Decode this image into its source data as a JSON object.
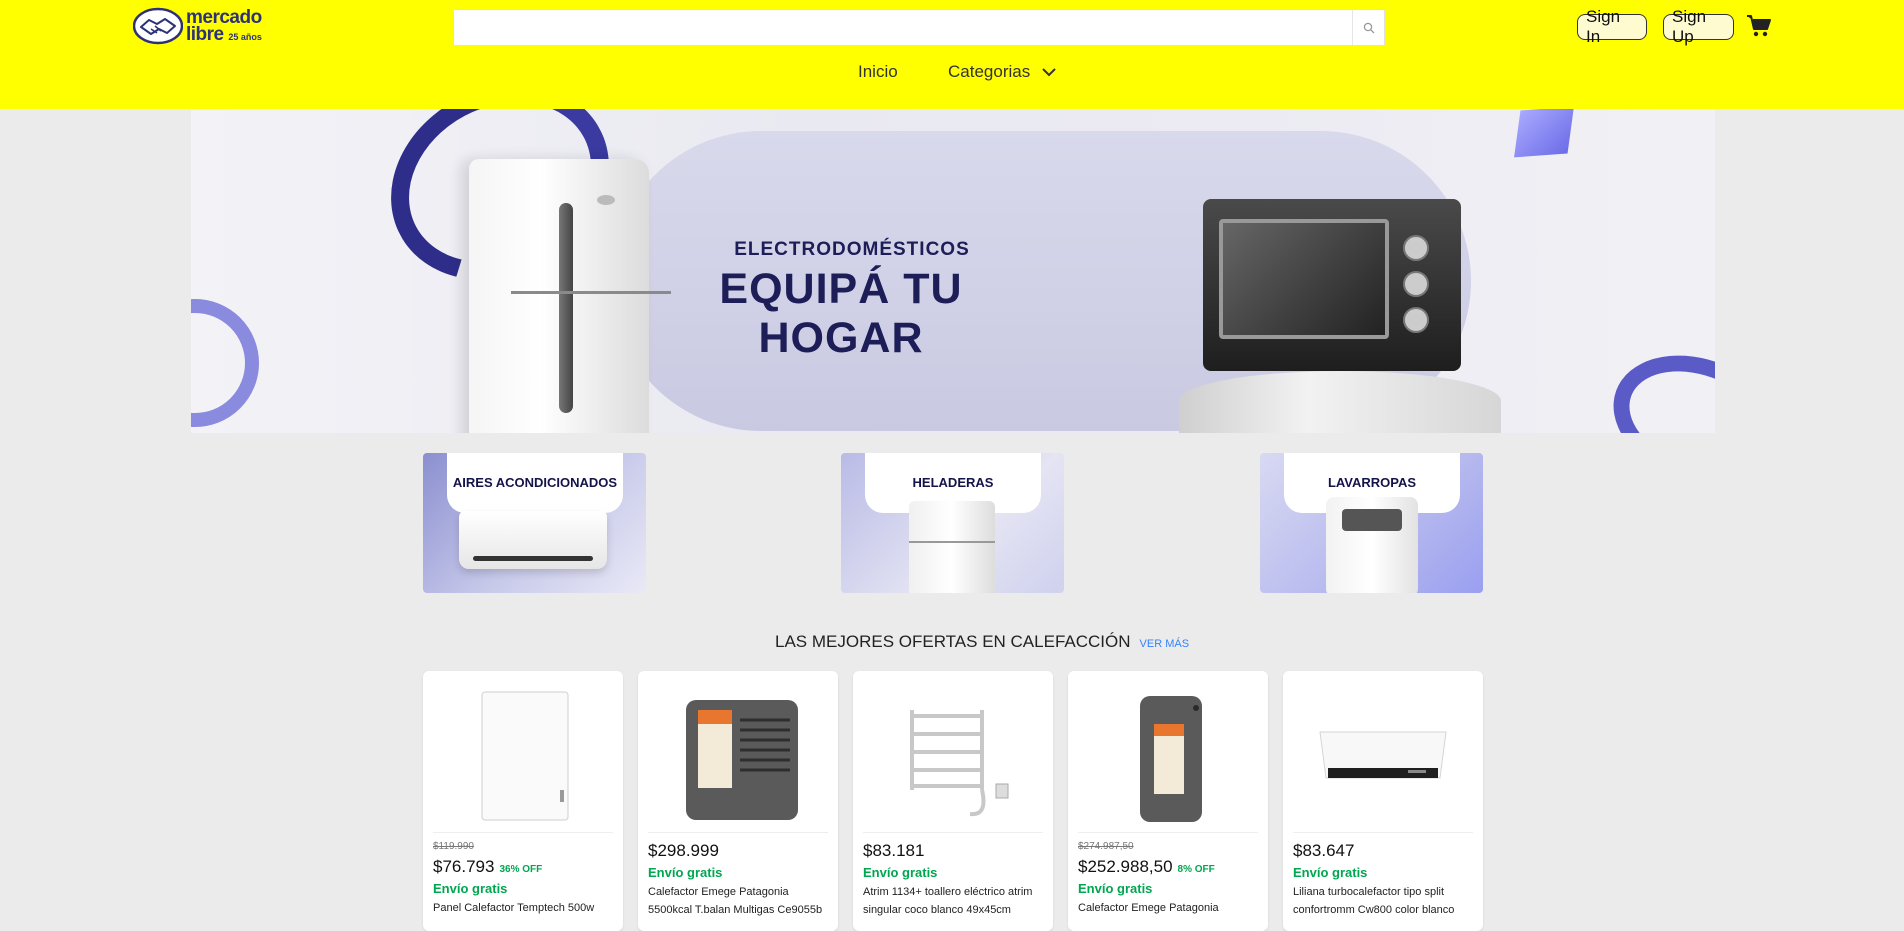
{
  "header": {
    "logo": {
      "brand_line1": "mercado",
      "brand_line2": "libre",
      "badge": "25 años"
    },
    "search": {
      "value": "",
      "placeholder": ""
    },
    "buttons": {
      "sign_in": "Sign In",
      "sign_up": "Sign Up"
    },
    "nav": {
      "home": "Inicio",
      "categories": "Categorias"
    },
    "icons": [
      "search-icon",
      "cart-icon",
      "chevron-down-icon"
    ],
    "colors": {
      "bar": "#ffff00",
      "brand": "#2d3277"
    }
  },
  "hero": {
    "subtitle": "ELECTRODOMÉSTICOS",
    "title": "EQUIPÁ TU HOGAR"
  },
  "categories": [
    {
      "label": "AIRES ACONDICIONADOS"
    },
    {
      "label": "HELADERAS"
    },
    {
      "label": "LAVARROPAS"
    }
  ],
  "offers": {
    "title": "LAS MEJORES OFERTAS EN CALEFACCIÓN",
    "more": "VER MÁS",
    "items": [
      {
        "old_price": "$119.990",
        "price": "$76.793",
        "discount": "36% OFF",
        "shipping": "Envío gratis",
        "title": "Panel Calefactor Temptech 500w"
      },
      {
        "old_price": "",
        "price": "$298.999",
        "discount": "",
        "shipping": "Envío gratis",
        "title": "Calefactor Emege Patagonia 5500kcal T.balan Multigas Ce9055b"
      },
      {
        "old_price": "",
        "price": "$83.181",
        "discount": "",
        "shipping": "Envío gratis",
        "title": "Atrim 1134+ toallero eléctrico atrim singular coco blanco 49x45cm"
      },
      {
        "old_price": "$274.987,50",
        "price": "$252.988,50",
        "discount": "8% OFF",
        "shipping": "Envío gratis",
        "title": "Calefactor Emege Patagonia"
      },
      {
        "old_price": "",
        "price": "$83.647",
        "discount": "",
        "shipping": "Envío gratis",
        "title": "Liliana turbocalefactor tipo split confortromm Cw800 color blanco"
      }
    ]
  }
}
